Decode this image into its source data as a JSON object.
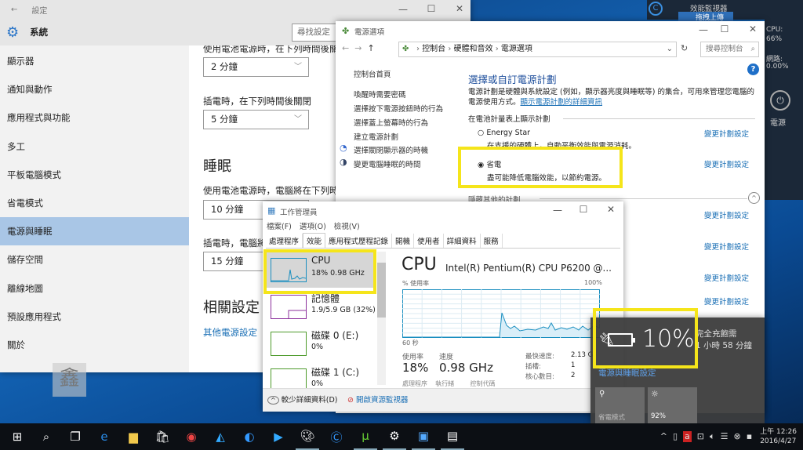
{
  "settings": {
    "title": "設定",
    "section": "系統",
    "search_placeholder": "尋找設定",
    "sidebar": [
      {
        "label": "顯示器"
      },
      {
        "label": "通知與動作"
      },
      {
        "label": "應用程式與功能"
      },
      {
        "label": "多工"
      },
      {
        "label": "平板電腦模式"
      },
      {
        "label": "省電模式"
      },
      {
        "label": "電源與睡眠",
        "selected": true
      },
      {
        "label": "儲存空間"
      },
      {
        "label": "離線地圖"
      },
      {
        "label": "預設應用程式"
      },
      {
        "label": "關於"
      }
    ],
    "screen_battery_label": "使用電池電源時，在下列時間後關閉",
    "screen_battery_value": "2 分鐘",
    "screen_plugged_label": "插電時，在下列時間後關閉",
    "screen_plugged_value": "5 分鐘",
    "sleep_heading": "睡眠",
    "sleep_battery_label": "使用電池電源時，電腦將在下列時間後睡眠",
    "sleep_battery_value": "10 分鐘",
    "sleep_plugged_label": "插電時，電腦將在下列時間後睡眠",
    "sleep_plugged_value": "15 分鐘",
    "related_heading": "相關設定",
    "related_link": "其他電源設定"
  },
  "control_panel": {
    "title": "電源選項",
    "breadcrumb": [
      "控制台",
      "硬體和音效",
      "電源選項"
    ],
    "search_placeholder": "搜尋控制台",
    "left_links": [
      "控制台首頁",
      "喚醒時需要密碼",
      "選擇按下電源按鈕時的行為",
      "選擇蓋上螢幕時的行為",
      "建立電源計劃",
      "選擇關閉顯示器的時機",
      "變更電腦睡眠的時間"
    ],
    "heading": "選擇或自訂電源計劃",
    "description": "電源計劃是硬體與系統設定 (例如，顯示器亮度與睡眠等) 的集合，可用來管理您電腦的電源使用方式。",
    "description_link": "顯示電源計劃的詳細資訊",
    "group_label": "在電池計量表上顯示計劃",
    "plans": [
      {
        "name": "Energy Star",
        "desc": "在支援的硬體上，自動平衡效能與電源消耗。",
        "selected": false
      },
      {
        "name": "省電",
        "desc": "盡可能降低電腦效能，以節約電源。",
        "selected": true
      }
    ],
    "hidden_plans_label": "隱藏其他的計劃",
    "change_plan_link": "變更計劃設定"
  },
  "task_manager": {
    "title": "工作管理員",
    "menu": [
      "檔案(F)",
      "選項(O)",
      "檢視(V)"
    ],
    "tabs": [
      "處理程序",
      "效能",
      "應用程式歷程記錄",
      "開機",
      "使用者",
      "詳細資料",
      "服務"
    ],
    "active_tab": "效能",
    "resources": [
      {
        "name": "CPU",
        "value": "18% 0.98 GHz",
        "color": "#1b8fc0"
      },
      {
        "name": "記憶體",
        "value": "1.9/5.9 GB (32%)",
        "color": "#8b2f9b"
      },
      {
        "name": "磁碟 0 (E:)",
        "value": "0%",
        "color": "#4d9a2a"
      },
      {
        "name": "磁碟 1 (C:)",
        "value": "0%",
        "color": "#4d9a2a"
      }
    ],
    "cpu_title": "CPU",
    "cpu_model": "Intel(R) Pentium(R) CPU P6200 @...",
    "graph_label": "% 使用率",
    "graph_max": "100%",
    "graph_time": "60 秒",
    "usage_label": "使用率",
    "usage_value": "18%",
    "speed_label": "速度",
    "speed_value": "0.98 GHz",
    "stats": [
      {
        "k": "最快速度:",
        "v": "2.13 G"
      },
      {
        "k": "插槽:",
        "v": "1"
      },
      {
        "k": "核心數目:",
        "v": "2"
      }
    ],
    "bottom_labels": [
      "處理程序",
      "執行緒",
      "控制代碼"
    ],
    "fewer_details": "較少詳細資料(D)",
    "open_resmon": "開啟資源監視器"
  },
  "battery_flyout": {
    "percent": "10%",
    "charge_line1": "完全充飽需",
    "charge_line2": "1 小時 58 分鐘",
    "settings_link": "電源與睡眠設定",
    "tile1": "省電模式",
    "tile2": "92%"
  },
  "perf_monitor": {
    "title": "效能監視器",
    "upload": "拖拽上傳",
    "cpu_label": "CPU:",
    "cpu_value": "66%",
    "net_label": "網路:",
    "net_value": "0.00%",
    "power_label": "電源"
  },
  "taskbar": {
    "time": "上午 12:26",
    "date": "2016/4/27"
  }
}
